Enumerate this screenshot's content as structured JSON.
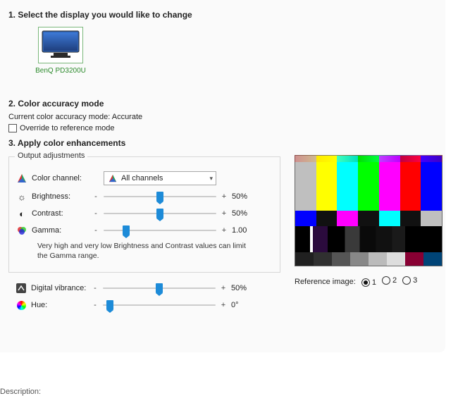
{
  "section1_title": "1. Select the display you would like to change",
  "monitor_name": "BenQ PD3200U",
  "section2_title": "2. Color accuracy mode",
  "current_mode_line": "Current color accuracy mode: Accurate",
  "override_label": "Override to reference mode",
  "override_checked": false,
  "section3_title": "3. Apply color enhancements",
  "group_label": "Output adjustments",
  "controls": {
    "channel_label": "Color channel:",
    "channel_value": "All channels",
    "brightness_label": "Brightness:",
    "brightness_value": "50%",
    "brightness_pct": 50,
    "contrast_label": "Contrast:",
    "contrast_value": "50%",
    "contrast_pct": 50,
    "gamma_label": "Gamma:",
    "gamma_value": "1.00",
    "gamma_pct": 18,
    "note": "Very high and very low Brightness and Contrast values can limit the Gamma range.",
    "vibrance_label": "Digital vibrance:",
    "vibrance_value": "50%",
    "vibrance_pct": 50,
    "hue_label": "Hue:",
    "hue_value": "0°",
    "hue_pct": 3
  },
  "reference_label": "Reference image:",
  "reference_options": [
    "1",
    "2",
    "3"
  ],
  "reference_selected": 0,
  "description_label": "Description:"
}
